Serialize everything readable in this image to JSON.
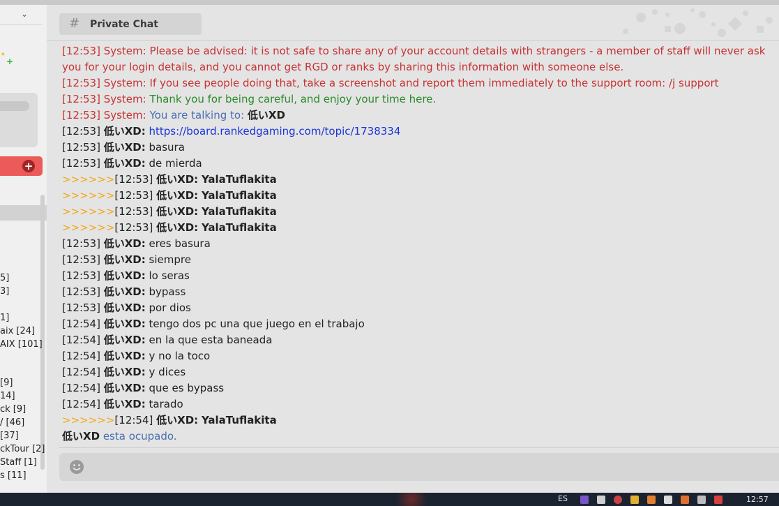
{
  "sidebar": {
    "list": [
      "5]",
      "3]",
      "1]",
      "aix [24]",
      "AIX [101]",
      "[9]",
      "14]",
      "ck [9]",
      "/ [46]",
      "[37]",
      "ckTour [2]",
      "Staff [1]",
      "s [11]"
    ]
  },
  "header": {
    "tab_label": "Private Chat"
  },
  "messages": {
    "s1": {
      "ts": "[12:53] System:",
      "text": "Please be advised: it is not safe to share any of your account details with strangers - a member of staff will never ask you for your login details, and you cannot get RGD or ranks by sharing this information with someone else."
    },
    "s2": {
      "ts": "[12:53] System:",
      "text": "If you see people doing that, take a screenshot and report them immediately to the support room: /j support"
    },
    "s3": {
      "ts": "[12:53] System:",
      "text": "Thank you for being careful, and enjoy your time here."
    },
    "s4": {
      "ts": "[12:53] System:",
      "text": "You are talking to:",
      "user": "低いXD"
    },
    "m1": {
      "ts": "[12:53]",
      "user": "低いXD:",
      "link": "https://board.rankedgaming.com/topic/1738334"
    },
    "m2": {
      "ts": "[12:53]",
      "user": "低いXD:",
      "text": "basura"
    },
    "m3": {
      "ts": "[12:53]",
      "user": "低いXD:",
      "text": "de mierda"
    },
    "o1": {
      "arrows": ">>>>>>",
      "ts": "[12:53]",
      "user": "低いXD:",
      "text": "YalaTuflakita"
    },
    "o2": {
      "arrows": ">>>>>>",
      "ts": "[12:53]",
      "user": "低いXD:",
      "text": "YalaTuflakita"
    },
    "o3": {
      "arrows": ">>>>>>",
      "ts": "[12:53]",
      "user": "低いXD:",
      "text": "YalaTuflakita"
    },
    "o4": {
      "arrows": ">>>>>>",
      "ts": "[12:53]",
      "user": "低いXD:",
      "text": "YalaTuflakita"
    },
    "m4": {
      "ts": "[12:53]",
      "user": "低いXD:",
      "text": "eres basura"
    },
    "m5": {
      "ts": "[12:53]",
      "user": "低いXD:",
      "text": "siempre"
    },
    "m6": {
      "ts": "[12:53]",
      "user": "低いXD:",
      "text": "lo seras"
    },
    "m7": {
      "ts": "[12:53]",
      "user": "低いXD:",
      "text": "bypass"
    },
    "m8": {
      "ts": "[12:53]",
      "user": "低いXD:",
      "text": "por dios"
    },
    "m9": {
      "ts": "[12:54]",
      "user": "低いXD:",
      "text": "tengo dos pc una que juego en el trabajo"
    },
    "m10": {
      "ts": "[12:54]",
      "user": "低いXD:",
      "text": "en la que esta baneada"
    },
    "m11": {
      "ts": "[12:54]",
      "user": "低いXD:",
      "text": "y no la toco"
    },
    "m12": {
      "ts": "[12:54]",
      "user": "低いXD:",
      "text": "y dices"
    },
    "m13": {
      "ts": "[12:54]",
      "user": "低いXD:",
      "text": "que es bypass"
    },
    "m14": {
      "ts": "[12:54]",
      "user": "低いXD:",
      "text": "tarado"
    },
    "o5": {
      "arrows": ">>>>>>",
      "ts": "[12:54]",
      "user": "低いXD:",
      "text": "YalaTuflakita"
    },
    "status": {
      "user": "低いXD",
      "text": "esta ocupado."
    }
  },
  "taskbar": {
    "lang": "ES",
    "clock": "12:57"
  },
  "icons": {
    "tab": "hash-icon",
    "composer": "smiley-icon",
    "add": "plus-icon",
    "dropdown": "chevron-down-icon"
  },
  "colors": {
    "system": "#c83232",
    "green": "#2a8a2a",
    "info": "#4a6eb0",
    "link": "#1a35d6",
    "arrows": "#f3a712",
    "accent": "#ec5a5a"
  }
}
